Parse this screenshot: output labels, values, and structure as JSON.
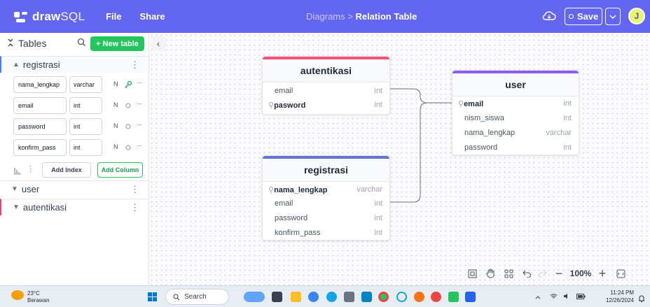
{
  "app": {
    "logo_bold": "draw",
    "logo_light": "SQL",
    "menu": [
      "File",
      "Share"
    ],
    "breadcrumb_parent": "Diagrams >",
    "breadcrumb_current": "Relation Table",
    "save_label": "Save",
    "avatar_initial": "J",
    "accent_color": "#6366f1"
  },
  "sidebar": {
    "tables_label": "Tables",
    "new_table_label": "+ New table",
    "sections": [
      {
        "name": "registrasi",
        "expanded": true
      },
      {
        "name": "user",
        "expanded": false
      },
      {
        "name": "autentikasi",
        "expanded": false
      }
    ],
    "fields": [
      {
        "name": "nama_lengkap",
        "type": "varchar",
        "nullable": "N",
        "key": true
      },
      {
        "name": "email",
        "type": "int",
        "nullable": "N",
        "key": false
      },
      {
        "name": "password",
        "type": "int",
        "nullable": "N",
        "key": false
      },
      {
        "name": "konfirm_pass",
        "type": "int",
        "nullable": "N",
        "key": false
      }
    ],
    "add_index_label": "Add Index",
    "add_column_label": "Add Column"
  },
  "diagram": {
    "tables": [
      {
        "name": "autentikasi",
        "color": "#f0527a",
        "columns": [
          {
            "name": "email",
            "type": "int",
            "pk": false
          },
          {
            "name": "pasword",
            "type": "int",
            "pk": true
          }
        ]
      },
      {
        "name": "user",
        "color": "#8b5cf6",
        "columns": [
          {
            "name": "email",
            "type": "int",
            "pk": true
          },
          {
            "name": "nism_siswa",
            "type": "int",
            "pk": false
          },
          {
            "name": "nama_lengkap",
            "type": "varchar",
            "pk": false
          },
          {
            "name": "password",
            "type": "int",
            "pk": false
          }
        ]
      },
      {
        "name": "registrasi",
        "color": "#6274d6",
        "columns": [
          {
            "name": "nama_lengkap",
            "type": "varchar",
            "pk": true
          },
          {
            "name": "email",
            "type": "int",
            "pk": false
          },
          {
            "name": "password",
            "type": "int",
            "pk": false
          },
          {
            "name": "konfirm_pass",
            "type": "int",
            "pk": false
          }
        ]
      }
    ],
    "zoom": "100%"
  },
  "taskbar": {
    "temperature": "23°C",
    "weather_label": "Berawan",
    "search_label": "Search",
    "time": "11:24 PM",
    "date": "12/26/2024"
  }
}
